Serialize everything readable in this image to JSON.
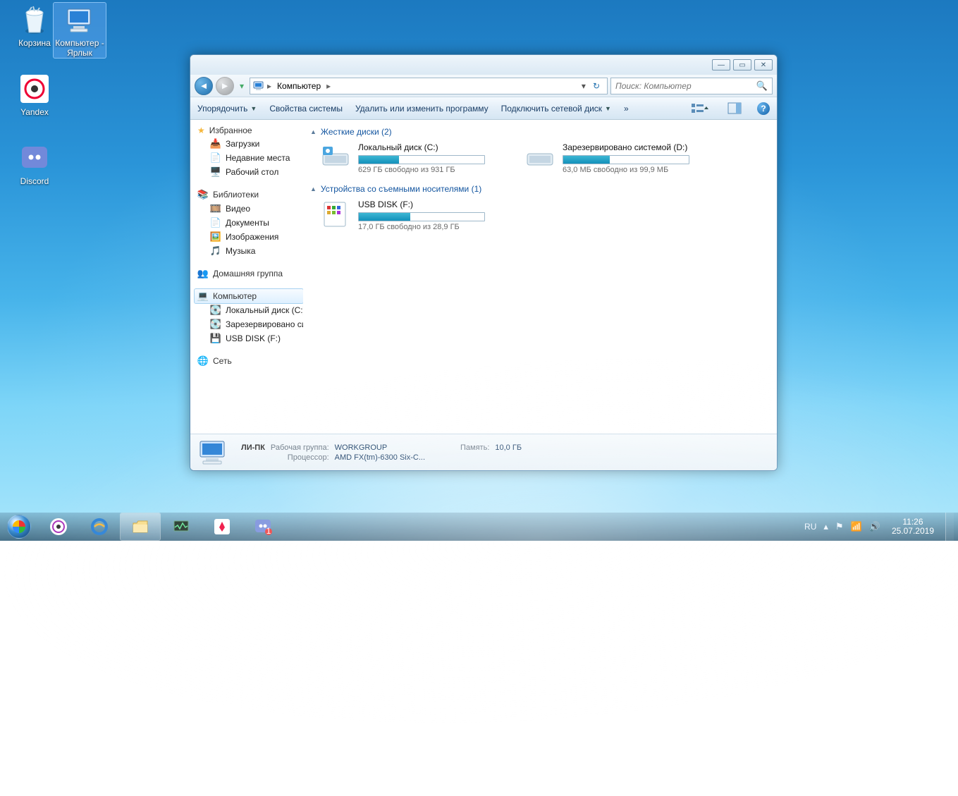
{
  "desktop_icons": [
    {
      "label": "Корзина"
    },
    {
      "label": "Компьютер - Ярлык"
    },
    {
      "label": "Yandex"
    },
    {
      "label": "Discord"
    }
  ],
  "window": {
    "breadcrumb": {
      "root_icon": "computer-icon",
      "item": "Компьютер"
    },
    "search_placeholder": "Поиск: Компьютер",
    "toolbar": {
      "organize": "Упорядочить",
      "sysprops": "Свойства системы",
      "uninstall": "Удалить или изменить программу",
      "mapdrive": "Подключить сетевой диск",
      "more": "»"
    },
    "nav": {
      "favorites": "Избранное",
      "fav_items": [
        "Загрузки",
        "Недавние места",
        "Рабочий стол"
      ],
      "libraries": "Библиотеки",
      "lib_items": [
        "Видео",
        "Документы",
        "Изображения",
        "Музыка"
      ],
      "homegroup": "Домашняя группа",
      "computer": "Компьютер",
      "comp_items": [
        "Локальный диск (C:)",
        "Зарезервировано системой (D:)",
        "USB DISK (F:)"
      ],
      "network": "Сеть"
    },
    "sections": {
      "hdd_header": "Жесткие диски (2)",
      "removable_header": "Устройства со съемными носителями (1)"
    },
    "drives": {
      "c": {
        "name": "Локальный диск (C:)",
        "free": "629 ГБ свободно из 931 ГБ",
        "pct": 32
      },
      "d": {
        "name": "Зарезервировано системой (D:)",
        "free": "63,0 МБ свободно из 99,9 МБ",
        "pct": 37
      },
      "f": {
        "name": "USB DISK (F:)",
        "free": "17,0 ГБ свободно из 28,9 ГБ",
        "pct": 41
      }
    },
    "details": {
      "name": "ЛИ-ПК",
      "workgroup_label": "Рабочая группа:",
      "workgroup": "WORKGROUP",
      "cpu_label": "Процессор:",
      "cpu": "AMD FX(tm)-6300 Six-C...",
      "mem_label": "Память:",
      "mem": "10,0 ГБ"
    }
  },
  "taskbar": {
    "lang": "RU",
    "time": "11:26",
    "date": "25.07.2019"
  }
}
